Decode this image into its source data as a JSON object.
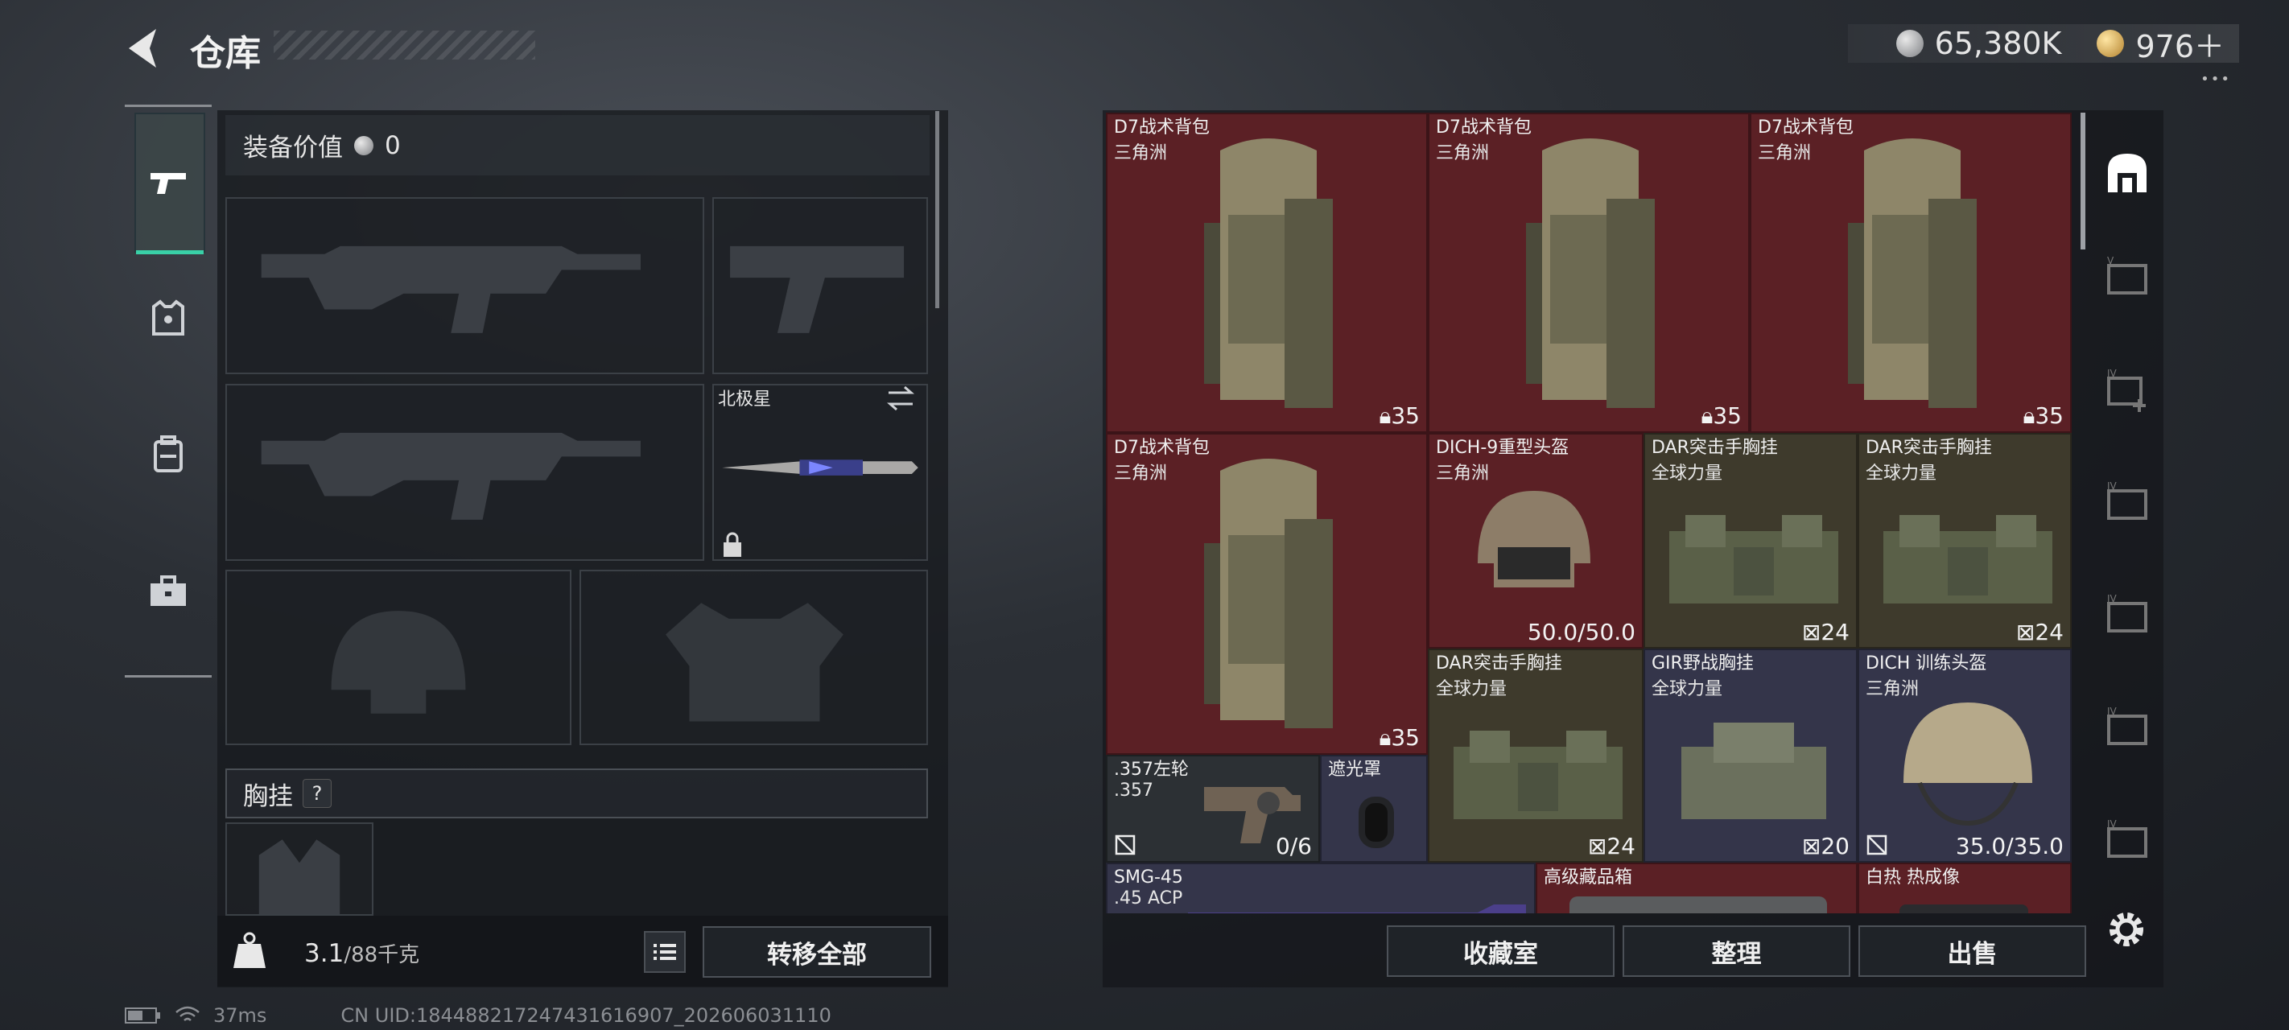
{
  "header": {
    "title": "仓库",
    "currency_coins": "65,380K",
    "currency_tickets": "976＋",
    "menu_dots": "•••"
  },
  "sidebar": {
    "tabs": [
      {
        "name": "weapons",
        "icon": "pistol-icon",
        "active": true
      },
      {
        "name": "armor",
        "icon": "armor-vest-icon",
        "active": false
      },
      {
        "name": "backpack",
        "icon": "backpack-icon",
        "active": false
      },
      {
        "name": "toolbox",
        "icon": "toolbox-icon",
        "active": false
      }
    ]
  },
  "equipment": {
    "value_label": "装备价值",
    "value": "0",
    "knife_name": "北极星",
    "chest_rig_label": "胸挂",
    "help": "?",
    "weight_current": "3.1",
    "weight_max": "/88千克",
    "transfer_all": "转移全部"
  },
  "stash": {
    "items": [
      {
        "name": "D7战术背包",
        "sub": "三角洲",
        "qty": "35",
        "color": "#5b2025"
      },
      {
        "name": "D7战术背包",
        "sub": "三角洲",
        "qty": "35",
        "color": "#5b2025"
      },
      {
        "name": "D7战术背包",
        "sub": "三角洲",
        "qty": "35",
        "color": "#5b2025"
      },
      {
        "name": "D7战术背包",
        "sub": "三角洲",
        "qty": "35",
        "color": "#5b2025"
      },
      {
        "name": "DICH-9重型头盔",
        "sub": "三角洲",
        "qty": "50.0/50.0",
        "color": "#5b2025"
      },
      {
        "name": "DAR突击手胸挂",
        "sub": "全球力量",
        "qty": "24",
        "color": "#3e3a2c"
      },
      {
        "name": "DAR突击手胸挂",
        "sub": "全球力量",
        "qty": "24",
        "color": "#3e3a2c"
      },
      {
        "name": "DAR突击手胸挂",
        "sub": "全球力量",
        "qty": "24",
        "color": "#3e3a2c"
      },
      {
        "name": "GIR野战胸挂",
        "sub": "全球力量",
        "qty": "20",
        "color": "#34354a"
      },
      {
        "name": "DICH 训练头盔",
        "sub": "三角洲",
        "qty": "35.0/35.0",
        "color": "#34354a"
      },
      {
        "name": ".357左轮",
        "sub": ".357",
        "qty": "0/6",
        "color": "#2c3034"
      },
      {
        "name": "遮光罩",
        "sub": "",
        "qty": "",
        "color": "#34354a"
      },
      {
        "name": "SMG-45",
        "sub": ".45 ACP",
        "qty": "",
        "color": "#34354a"
      },
      {
        "name": "高级藏品箱",
        "sub": "",
        "qty": "",
        "color": "#5b2025"
      },
      {
        "name": "白热 热成像",
        "sub": "",
        "qty": "",
        "color": "#5b2025"
      }
    ]
  },
  "actions": {
    "collection": "收藏室",
    "organize": "整理",
    "sell": "出售"
  },
  "status": {
    "ping": "37ms",
    "uid": "CN UID:1844882172474316169​07_202606031110"
  }
}
